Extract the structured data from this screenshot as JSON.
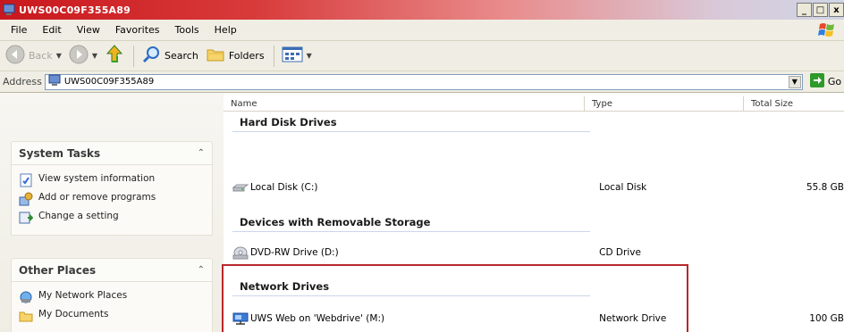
{
  "window": {
    "title": "UWS00C09F355A89",
    "buttons": [
      "_",
      "□",
      "x"
    ]
  },
  "menu": [
    "File",
    "Edit",
    "View",
    "Favorites",
    "Tools",
    "Help"
  ],
  "toolbar": {
    "back": "Back",
    "search": "Search",
    "folders": "Folders"
  },
  "address": {
    "label": "Address",
    "value": "UWS00C09F355A89",
    "go": "Go"
  },
  "task_pane": {
    "system_tasks": {
      "title": "System Tasks",
      "items": [
        "View system information",
        "Add or remove programs",
        "Change a setting"
      ]
    },
    "other_places": {
      "title": "Other Places",
      "items": [
        "My Network Places",
        "My Documents"
      ]
    }
  },
  "list": {
    "columns": [
      "Name",
      "Type",
      "Total Size"
    ],
    "groups": [
      {
        "title": "Hard Disk Drives",
        "items": [
          {
            "name": "Local Disk (C:)",
            "type": "Local Disk",
            "size": "55.8 GB",
            "icon": "hard-disk-icon"
          }
        ]
      },
      {
        "title": "Devices with Removable Storage",
        "items": [
          {
            "name": "DVD-RW Drive (D:)",
            "type": "CD Drive",
            "size": "",
            "icon": "dvd-drive-icon"
          }
        ]
      },
      {
        "title": "Network Drives",
        "items": [
          {
            "name": "UWS Web on 'Webdrive' (M:)",
            "type": "Network Drive",
            "size": "100 GB",
            "icon": "network-drive-icon"
          }
        ]
      }
    ]
  },
  "colors": {
    "title_bar": "#c9181d",
    "highlight_box": "#b8262b"
  }
}
